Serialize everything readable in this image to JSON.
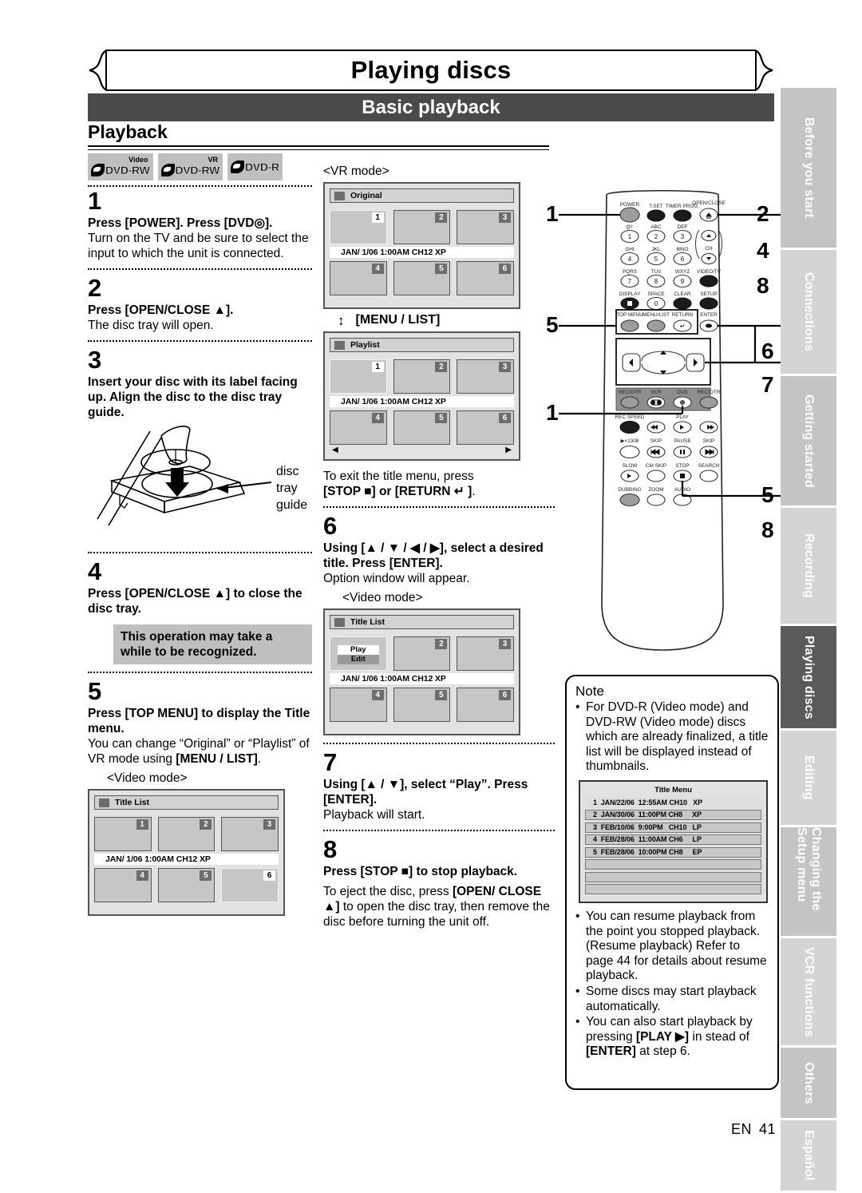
{
  "header": {
    "page_title": "Playing discs",
    "section_bar": "Basic playback",
    "sub_head": "Playback"
  },
  "disc_logos": [
    {
      "sup": "Video",
      "name": "DVD-RW"
    },
    {
      "sup": "VR",
      "name": "DVD-RW"
    },
    {
      "sup": "",
      "name": "DVD-R"
    }
  ],
  "steps": {
    "s1": {
      "num": "1",
      "bold": "Press [POWER]. Press [DVD◎].",
      "body": "Turn on the TV and be sure to select the input to which the unit is connected."
    },
    "s2": {
      "num": "2",
      "bold": "Press [OPEN/CLOSE ▲].",
      "body": "The disc tray will open."
    },
    "s3": {
      "num": "3",
      "bold": "Insert your disc with its label facing up. Align the disc to the disc tray guide.",
      "illustration_label": "disc\ntray\nguide"
    },
    "s4": {
      "num": "4",
      "bold": "Press [OPEN/CLOSE ▲] to close the disc tray.",
      "callout": "This operation may take a while to be recognized."
    },
    "s5": {
      "num": "5",
      "bold": "Press [TOP MENU] to display the Title menu.",
      "body": "You can change “Original” or “Playlist” of  VR mode using",
      "body_bold_tail": "[MENU / LIST]",
      "mode_label": "<Video mode>"
    },
    "s6": {
      "num": "6",
      "bold": "Using [▲ / ▼ / ◀ / ▶], select a desired title. Press [ENTER].",
      "body": "Option window will appear.",
      "mode_label": "<Video mode>"
    },
    "s7": {
      "num": "7",
      "bold": "Using [▲ / ▼], select “Play”. Press [ENTER].",
      "body": "Playback will start."
    },
    "s8": {
      "num": "8",
      "bold": "Press [STOP ■] to stop playback.",
      "body_pre": "To eject the disc, press ",
      "body_bold1": "[OPEN/ CLOSE ▲]",
      "body_mid": " to open the disc tray, then remove the disc before turning the unit off."
    }
  },
  "mid_column": {
    "vr_mode_label": "<VR mode>",
    "menu_list_label": "[MENU / LIST]",
    "exit_text_pre": "To exit the title menu, press",
    "exit_text_bold": "[STOP ■] or [RETURN ↵ ]",
    "exit_text_post": "."
  },
  "osd_screens": {
    "original": {
      "title": "Original",
      "info": "JAN/ 1/06 1:00AM CH12 XP",
      "thumbs_top": [
        "1",
        "2",
        "3"
      ],
      "thumbs_bottom": [
        "4",
        "5",
        "6"
      ],
      "selected": "1"
    },
    "playlist": {
      "title": "Playlist",
      "info": "JAN/ 1/06 1:00AM CH12 XP",
      "thumbs_top": [
        "1",
        "2",
        "3"
      ],
      "thumbs_bottom": [
        "4",
        "5",
        "6"
      ],
      "selected": "1",
      "left_arrow": "◀",
      "right_arrow": "▶"
    },
    "title_list_video": {
      "title": "Title List",
      "info": "JAN/ 1/06 1:00AM CH12 XP",
      "thumbs_top": [
        "1",
        "2",
        "3"
      ],
      "thumbs_bottom": [
        "4",
        "5",
        "6"
      ],
      "selected": "6"
    },
    "title_list_option": {
      "title": "Title List",
      "info": "JAN/ 1/06 1:00AM CH12 XP",
      "thumbs_top": [
        "",
        "2",
        "3"
      ],
      "thumbs_bottom": [
        "4",
        "5",
        "6"
      ],
      "option_play": "Play",
      "option_edit": "Edit"
    }
  },
  "remote": {
    "labels": {
      "power": "POWER",
      "tset": "T.SET",
      "timer_prog": "TIMER PROG.",
      "open_close": "OPEN/CLOSE",
      "k1": "@!:",
      "k2": "ABC",
      "k3": "DEF",
      "k4": "GHI",
      "k5": "JKL",
      "k6": "MNO",
      "k7": "PQRS",
      "k8": "TUV",
      "k9": "WXYZ",
      "display": "DISPLAY",
      "space": "SPACE",
      "clear": "CLEAR",
      "ch": "CH",
      "video_tv": "VIDEO/TV",
      "setup": "SETUP",
      "top_menu": "TOP MENU",
      "menu_list": "MENU/LIST",
      "return": "RETURN",
      "enter": "ENTER",
      "rec_otr_l": "REC/OTR",
      "vcr": "VCR",
      "dvd": "DVD",
      "rec_otr_r": "REC/OTR",
      "rec_speed": "REC SPEED",
      "play": "PLAY",
      "x1308": "▶×1308",
      "skip_l": "SKIP",
      "pause": "PAUSE",
      "skip_r": "SKIP",
      "slow": "SLOW",
      "cm_skip": "CM SKIP",
      "stop": "STOP",
      "search": "SEARCH",
      "dubbing": "DUBBING",
      "zoom": "ZOOM",
      "audio": "AUDIO"
    },
    "keypad": [
      "1",
      "2",
      "3",
      "4",
      "5",
      "6",
      "7",
      "8",
      "9",
      "0"
    ],
    "callouts": {
      "c_power": "1",
      "c_open": "2",
      "c_four": "4",
      "c_eight": "8",
      "c_topmenu": "5",
      "c_enter": "6",
      "c_arrow": "7",
      "c_dvd": "1",
      "c_stop": "5",
      "c_bottom8": "8"
    }
  },
  "note": {
    "heading": "Note",
    "bullets": [
      "For DVD-R (Video mode) and DVD-RW (Video mode) discs which are already finalized, a title list will be displayed instead of thumbnails.",
      "You can resume playback from the point you stopped playback. (Resume playback) Refer to page 44 for details about resume playback.",
      "Some discs may start playback automatically."
    ],
    "bullet_last_pre": "You can also start playback by pressing ",
    "bullet_last_bold": "[PLAY ▶]",
    "bullet_last_mid": " in stead of ",
    "bullet_last_bold2": "[ENTER]",
    "bullet_last_post": " at step 6."
  },
  "title_menu": {
    "heading": "Title Menu",
    "rows": [
      "1  JAN/22/06  12:55AM CH10   XP",
      "2  JAN/30/06  11:00PM CH8     XP",
      "3  FEB/10/06  9:00PM   CH10   LP",
      "4  FEB/28/06  11:00AM CH6     LP",
      "5  FEB/28/06  10:00PM CH8     EP",
      "",
      "",
      ""
    ]
  },
  "tabs": [
    {
      "label": "Before you start",
      "active": false
    },
    {
      "label": "Connections",
      "active": false
    },
    {
      "label": "Getting started",
      "active": false
    },
    {
      "label": "Recording",
      "active": false
    },
    {
      "label": "Playing discs",
      "active": true
    },
    {
      "label": "Editing",
      "active": false
    },
    {
      "label": "Changing the Setup menu",
      "active": false
    },
    {
      "label": "VCR functions",
      "active": false
    },
    {
      "label": "Others",
      "active": false
    },
    {
      "label": "Español",
      "active": false
    }
  ],
  "footer": {
    "lang": "EN",
    "page": "41"
  }
}
